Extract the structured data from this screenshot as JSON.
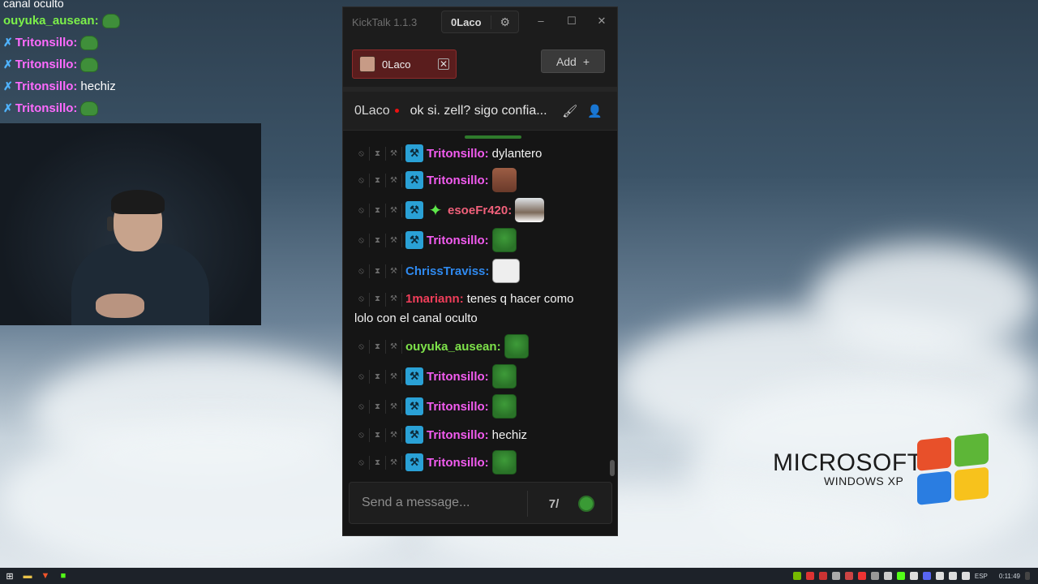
{
  "overlay_chat": {
    "top_fragment": "canal oculto",
    "lines": [
      {
        "user": "ouyuka_ausean",
        "sep": ":",
        "text": "",
        "badge": false,
        "color": "green"
      },
      {
        "user": "Tritonsillo",
        "sep": ":",
        "text": "",
        "badge": true,
        "color": "pink"
      },
      {
        "user": "Tritonsillo",
        "sep": ":",
        "text": "",
        "badge": true,
        "color": "pink"
      },
      {
        "user": "Tritonsillo",
        "sep": ":",
        "text": "hechiz",
        "badge": true,
        "color": "pink"
      },
      {
        "user": "Tritonsillo",
        "sep": ":",
        "text": "",
        "badge": true,
        "color": "pink"
      }
    ]
  },
  "kicktalk": {
    "app_name": "KickTalk 1.1.3",
    "account": "0Laco",
    "settings_icon": "gear-icon",
    "window_controls": {
      "minimize": "–",
      "maximize": "☐",
      "close": "✕"
    },
    "tab": {
      "name": "0Laco",
      "close": "✕"
    },
    "add_button": {
      "label": "Add",
      "icon": "+"
    },
    "channel": {
      "name": "0Laco",
      "live": true,
      "stream_title": "ok si. zell? sigo confia..."
    },
    "messages": [
      {
        "user": "Tritonsillo",
        "text": "dylantero",
        "emote": "",
        "badges": [
          "mod"
        ],
        "color": "pink"
      },
      {
        "user": "Tritonsillo",
        "text": "",
        "emote": "face",
        "badges": [
          "mod"
        ],
        "color": "pink"
      },
      {
        "user": "esoeFr420",
        "text": "",
        "emote": "man",
        "badges": [
          "mod",
          "star"
        ],
        "color": "salmon"
      },
      {
        "user": "Tritonsillo",
        "text": "",
        "emote": "pepe",
        "badges": [
          "mod"
        ],
        "color": "pink"
      },
      {
        "user": "ChrissTraviss",
        "text": "",
        "emote": "meme",
        "badges": [],
        "color": "blue"
      },
      {
        "user": "1mariann",
        "text": "tenes q hacer como",
        "text2": "lolo con el canal oculto",
        "emote": "",
        "badges": [],
        "color": "red"
      },
      {
        "user": "ouyuka_ausean",
        "text": "",
        "emote": "pepe",
        "badges": [],
        "color": "green"
      },
      {
        "user": "Tritonsillo",
        "text": "",
        "emote": "pepe",
        "badges": [
          "mod"
        ],
        "color": "pink"
      },
      {
        "user": "Tritonsillo",
        "text": "",
        "emote": "pepe",
        "badges": [
          "mod"
        ],
        "color": "pink"
      },
      {
        "user": "Tritonsillo",
        "text": "hechiz",
        "emote": "",
        "badges": [
          "mod"
        ],
        "color": "pink"
      },
      {
        "user": "Tritonsillo",
        "text": "",
        "emote": "pepe",
        "badges": [
          "mod"
        ],
        "color": "pink"
      }
    ],
    "input_placeholder": "Send a message..."
  },
  "desktop": {
    "xp_brand": "MICROSOFT",
    "xp_product": "WINDOWS XP"
  },
  "taskbar": {
    "language": "ESP",
    "clock": "0:11:49"
  },
  "colors": {
    "accent_green": "#53fc18",
    "tab_bg": "#5a1d1d",
    "mod_badge": "#2aa1d6"
  }
}
